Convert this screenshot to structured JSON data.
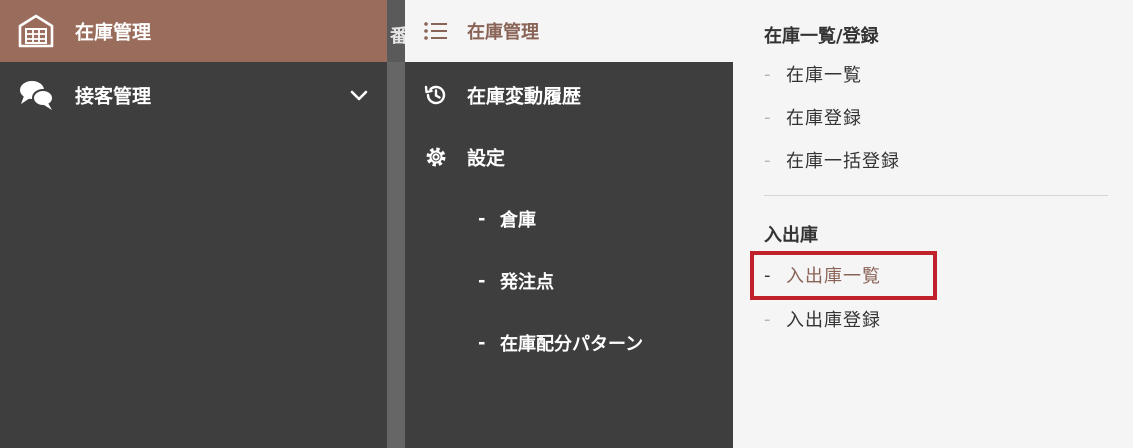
{
  "colors": {
    "sidebar_bg": "#3e3e3e",
    "active_bg": "#9a6c5b",
    "accent_text": "#8a6357",
    "panel_bg": "#f5f5f5",
    "highlight_border": "#c0212a"
  },
  "sidebar": {
    "items": [
      {
        "label": "在庫管理",
        "icon": "warehouse-icon",
        "active": true
      },
      {
        "label": "接客管理",
        "icon": "chat-bubbles-icon",
        "expandable": true
      }
    ]
  },
  "strip": {
    "glyph": "番"
  },
  "submenu": {
    "header": {
      "label": "在庫管理",
      "icon": "list-icon"
    },
    "items": [
      {
        "label": "在庫変動履歴",
        "icon": "history-icon"
      },
      {
        "label": "設定",
        "icon": "gear-icon"
      }
    ],
    "settings_children": [
      {
        "dash": "-",
        "label": "倉庫"
      },
      {
        "dash": "-",
        "label": "発注点"
      },
      {
        "dash": "-",
        "label": "在庫配分パターン"
      }
    ]
  },
  "panel": {
    "groups": [
      {
        "title": "在庫一覧/登録",
        "links": [
          {
            "dash": "-",
            "label": "在庫一覧"
          },
          {
            "dash": "-",
            "label": "在庫登録"
          },
          {
            "dash": "-",
            "label": "在庫一括登録"
          }
        ]
      },
      {
        "title": "入出庫",
        "links": [
          {
            "dash": "-",
            "label": "入出庫一覧",
            "highlighted": true
          },
          {
            "dash": "-",
            "label": "入出庫登録"
          }
        ]
      }
    ]
  }
}
